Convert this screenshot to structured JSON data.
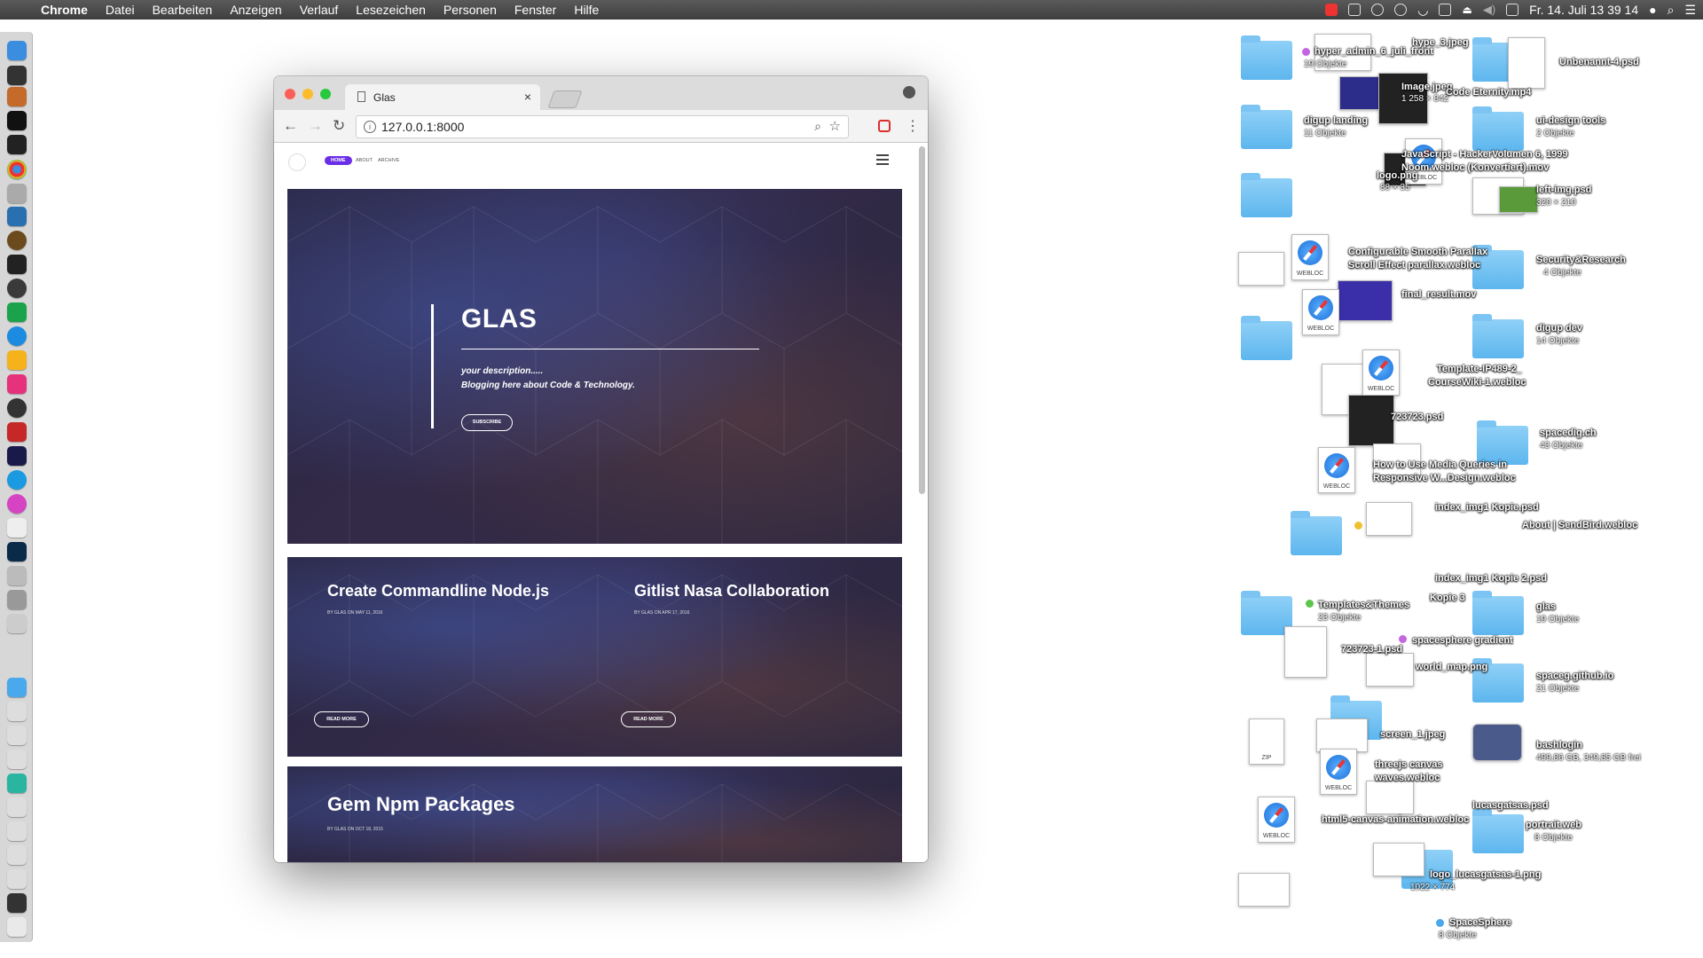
{
  "menubar": {
    "app": "Chrome",
    "items": [
      "Datei",
      "Bearbeiten",
      "Anzeigen",
      "Verlauf",
      "Lesezeichen",
      "Personen",
      "Fenster",
      "Hilfe"
    ],
    "clock": "Fr. 14. Juli  13 39 14"
  },
  "browser": {
    "tab_title": "Glas",
    "url": "127.0.0.1:8000"
  },
  "site": {
    "nav": {
      "home": "HOME",
      "about": "ABOUT",
      "archive": "ARCHIVE"
    },
    "hero": {
      "title": "GLAS",
      "desc_line1": "your description.....",
      "desc_line2": "Blogging here about Code & Technology.",
      "subscribe": "SUBSCRIBE"
    },
    "posts": [
      {
        "title": "Create Commandline Node.js",
        "meta": "BY GLAS ON MAY 11, 2016",
        "button": "READ MORE"
      },
      {
        "title": "Gitlist Nasa Collaboration",
        "meta": "BY GLAS ON APR 17, 2016",
        "button": "READ MORE"
      },
      {
        "title": "Gem Npm Packages",
        "meta": "BY GLAS ON OCT 18, 2015"
      }
    ]
  },
  "desktop": {
    "labels": [
      {
        "text": "hype_3.jpeg"
      },
      {
        "text": "hyper_admin_6_juli_front"
      },
      {
        "text": "19 Objekte"
      },
      {
        "text": "Unbenannt-4.psd"
      },
      {
        "text": "Image.jpeg"
      },
      {
        "text": "1 258 × 842"
      },
      {
        "text": "Code Eternity.mp4"
      },
      {
        "text": "digup landing"
      },
      {
        "text": "11 Objekte"
      },
      {
        "text": "ui-design tools"
      },
      {
        "text": "2 Objekte"
      },
      {
        "text": "JavaScript - HackerVolumen 6, 1999"
      },
      {
        "text": "Noom.webloc (Konvertiert).mov"
      },
      {
        "text": "logo.png"
      },
      {
        "text": "88 × 35"
      },
      {
        "text": "left-img.psd"
      },
      {
        "text": "320 × 210"
      },
      {
        "text": "Configurable Smooth Parallax"
      },
      {
        "text": "Scroll Effect parallax.webloc"
      },
      {
        "text": "Security&Research"
      },
      {
        "text": "4 Objekte"
      },
      {
        "text": "final_result.mov"
      },
      {
        "text": "digup dev"
      },
      {
        "text": "14 Objekte"
      },
      {
        "text": "Template-IP489-2_"
      },
      {
        "text": "CourseWiki-1.webloc"
      },
      {
        "text": "723723.psd"
      },
      {
        "text": "spacedig.ch"
      },
      {
        "text": "43 Objekte"
      },
      {
        "text": "How to Use Media Queries in"
      },
      {
        "text": "Responsive W...Design.webloc"
      },
      {
        "text": "index_img1 Kopie.psd"
      },
      {
        "text": "About | SendBird.webloc"
      },
      {
        "text": "Kopie 3"
      },
      {
        "text": "index_img1 Kopie 2.psd"
      },
      {
        "text": "Templates&Themes"
      },
      {
        "text": "23 Objekte"
      },
      {
        "text": "glas"
      },
      {
        "text": "19 Objekte"
      },
      {
        "text": "723723-1.psd"
      },
      {
        "text": "world_map.png"
      },
      {
        "text": "spaceg.github.io"
      },
      {
        "text": "21 Objekte"
      },
      {
        "text": "spacesphere gradient"
      },
      {
        "text": "screen_1.jpeg"
      },
      {
        "text": "bashlogin"
      },
      {
        "text": "499,86 GB, 349,85 GB frei"
      },
      {
        "text": "threejs canvas"
      },
      {
        "text": "waves.webloc"
      },
      {
        "text": "lucasgatsas.psd"
      },
      {
        "text": "html5-canvas-animation.webloc"
      },
      {
        "text": "portrait.web"
      },
      {
        "text": "8 Objekte"
      },
      {
        "text": "logo_lucasgatsas-1.png"
      },
      {
        "text": "1022 × 774"
      },
      {
        "text": "SpaceSphere"
      },
      {
        "text": "8 Objekte"
      }
    ],
    "webloc_tag": "WEBLOC",
    "zip_tag": "ZIP"
  },
  "colors": {
    "menubar": "#4a4a4a",
    "accent_pill": "#6b2ee6",
    "folder": "#6cbdf1",
    "hero_bg": "#2c2946"
  }
}
